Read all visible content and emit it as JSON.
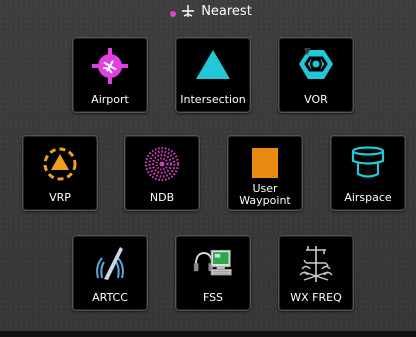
{
  "header": {
    "title": "Nearest",
    "dot_color": "#e040e0"
  },
  "tiles": [
    {
      "label": "Airport",
      "icon": "airport-icon"
    },
    {
      "label": "Intersection",
      "icon": "intersection-icon"
    },
    {
      "label": "VOR",
      "icon": "vor-icon"
    },
    {
      "label": "VRP",
      "icon": "vrp-icon"
    },
    {
      "label": "NDB",
      "icon": "ndb-icon"
    },
    {
      "label": "User Waypoint",
      "label_line1": "User",
      "label_line2": "Waypoint",
      "icon": "user-waypoint-icon"
    },
    {
      "label": "Airspace",
      "icon": "airspace-icon"
    },
    {
      "label": "ARTCC",
      "icon": "artcc-icon"
    },
    {
      "label": "FSS",
      "icon": "fss-icon"
    },
    {
      "label": "WX FREQ",
      "icon": "wx-freq-icon"
    }
  ],
  "colors": {
    "airport": "#e040e0",
    "intersection": "#22c8d8",
    "vor": "#22c8d8",
    "vrp": "#f0a020",
    "ndb": "#d040c0",
    "user_waypoint": "#e88a10",
    "airspace": "#22c8d8",
    "artcc": "#5aa8d8"
  }
}
